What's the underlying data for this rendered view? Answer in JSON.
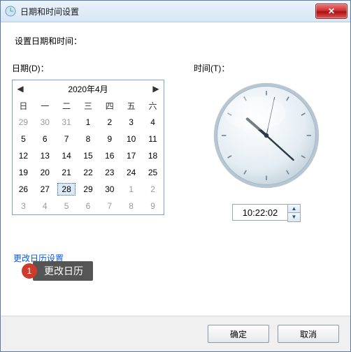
{
  "window": {
    "title": "日期和时间设置"
  },
  "subtitle": "设置日期和时间：",
  "labels": {
    "date": "日期(D)：",
    "time": "时间(T)："
  },
  "calendar": {
    "title": "2020年4月",
    "weekdays": [
      "日",
      "一",
      "二",
      "三",
      "四",
      "五",
      "六"
    ],
    "cells": [
      {
        "d": "29",
        "oth": true
      },
      {
        "d": "30",
        "oth": true
      },
      {
        "d": "31",
        "oth": true
      },
      {
        "d": "1"
      },
      {
        "d": "2"
      },
      {
        "d": "3"
      },
      {
        "d": "4"
      },
      {
        "d": "5"
      },
      {
        "d": "6"
      },
      {
        "d": "7"
      },
      {
        "d": "8"
      },
      {
        "d": "9"
      },
      {
        "d": "10"
      },
      {
        "d": "11"
      },
      {
        "d": "12"
      },
      {
        "d": "13"
      },
      {
        "d": "14"
      },
      {
        "d": "15"
      },
      {
        "d": "16"
      },
      {
        "d": "17"
      },
      {
        "d": "18"
      },
      {
        "d": "19"
      },
      {
        "d": "20"
      },
      {
        "d": "21"
      },
      {
        "d": "22"
      },
      {
        "d": "23"
      },
      {
        "d": "24"
      },
      {
        "d": "25"
      },
      {
        "d": "26"
      },
      {
        "d": "27"
      },
      {
        "d": "28",
        "sel": true
      },
      {
        "d": "29"
      },
      {
        "d": "30"
      },
      {
        "d": "1",
        "oth": true
      },
      {
        "d": "2",
        "oth": true
      },
      {
        "d": "3",
        "oth": true
      },
      {
        "d": "4",
        "oth": true
      },
      {
        "d": "5",
        "oth": true
      },
      {
        "d": "6",
        "oth": true
      },
      {
        "d": "7",
        "oth": true
      },
      {
        "d": "8",
        "oth": true
      },
      {
        "d": "9",
        "oth": true
      }
    ]
  },
  "time": {
    "value": "10:22:02",
    "h": 10,
    "m": 22,
    "s": 2
  },
  "link": {
    "text": "更改日历设置"
  },
  "callout": {
    "badge": "1",
    "text": "更改日历"
  },
  "buttons": {
    "ok": "确定",
    "cancel": "取消"
  },
  "icons": {
    "prev": "◀",
    "next": "▶",
    "up": "▲",
    "down": "▼",
    "close": "✕"
  },
  "colors": {
    "accent": "#0a5bd6",
    "close": "#c33",
    "badge": "#d03a2b"
  }
}
